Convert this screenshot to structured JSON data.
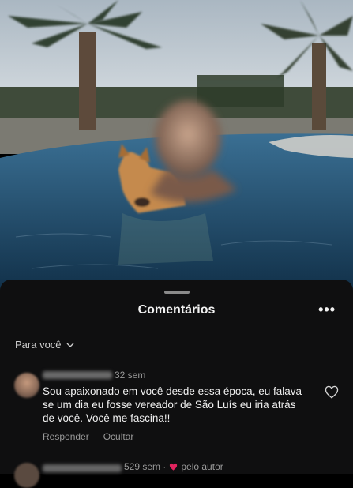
{
  "sheet": {
    "title": "Comentários",
    "more_label": "•••",
    "filter_label": "Para você"
  },
  "comments": [
    {
      "time": "32 sem",
      "text": "Sou apaixonado em você desde essa época, eu falava se um dia eu fosse vereador de São Luís eu iria atrás de você. Você me fascina!!",
      "reply_label": "Responder",
      "hide_label": "Ocultar"
    }
  ],
  "next_comment": {
    "time": "529 sem ·",
    "author_badge": "pelo autor"
  },
  "colors": {
    "sheet_bg": "#0f0f10",
    "heart_red": "#e0245e"
  },
  "icons": [
    "chevron-down-icon",
    "heart-outline-icon",
    "heart-filled-icon",
    "more-icon"
  ]
}
